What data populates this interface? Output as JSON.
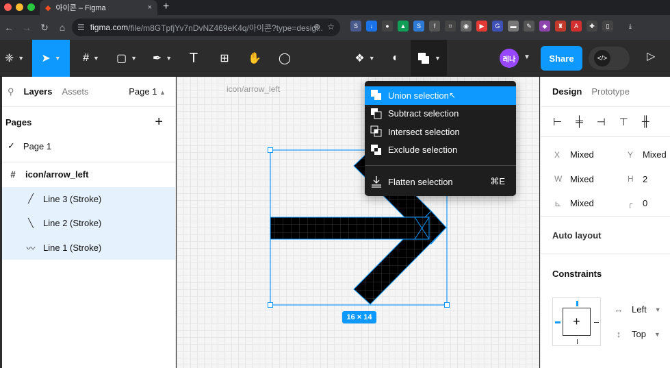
{
  "browser": {
    "tab_title": "아이콘 – Figma",
    "tab_close": "×",
    "new_tab": "+",
    "url_host": "figma.com",
    "url_path": "/file/m8GTpfjYv7nDvNZ469eK4q/아이콘?type=desig..."
  },
  "toolbar": {
    "share_label": "Share",
    "avatar_label": "레나"
  },
  "left_panel": {
    "tab_layers": "Layers",
    "tab_assets": "Assets",
    "page_selector": "Page 1",
    "pages_heading": "Pages",
    "pages": [
      {
        "label": "Page 1"
      }
    ],
    "frame_layer": "icon/arrow_left",
    "layers": [
      {
        "label": "Line 3 (Stroke)"
      },
      {
        "label": "Line 2 (Stroke)"
      },
      {
        "label": "Line 1 (Stroke)"
      }
    ]
  },
  "canvas": {
    "frame_label": "icon/arrow_left",
    "dimensions": "16 × 14"
  },
  "boolean_menu": {
    "items": [
      {
        "label": "Union selection"
      },
      {
        "label": "Subtract selection"
      },
      {
        "label": "Intersect selection"
      },
      {
        "label": "Exclude selection"
      }
    ],
    "flatten_label": "Flatten selection",
    "flatten_shortcut": "⌘E"
  },
  "right_panel": {
    "tab_design": "Design",
    "tab_prototype": "Prototype",
    "x_label": "X",
    "x_value": "Mixed",
    "y_label": "Y",
    "y_value": "Mixed",
    "w_label": "W",
    "w_value": "Mixed",
    "h_label": "H",
    "h_value": "2",
    "rotation_value": "Mixed",
    "radius_value": "0",
    "auto_layout": "Auto layout",
    "constraints": "Constraints",
    "horizontal_constraint": "Left",
    "vertical_constraint": "Top"
  },
  "colors": {
    "accent": "#0d99ff",
    "toolbar_bg": "#2c2c2c",
    "selection_bg": "#e5f2fd"
  }
}
